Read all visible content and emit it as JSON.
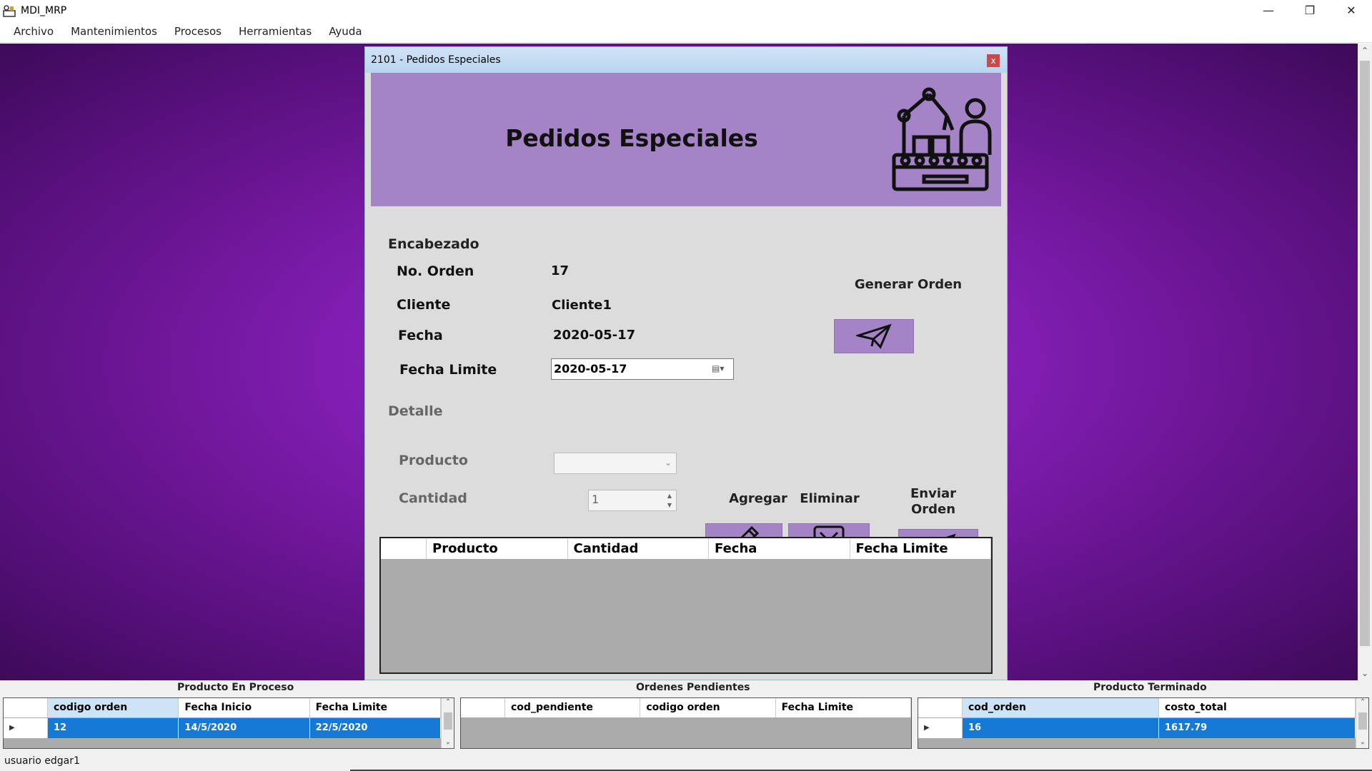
{
  "window": {
    "title": "MDI_MRP"
  },
  "menu": [
    "Archivo",
    "Mantenimientos",
    "Procesos",
    "Herramientas",
    "Ayuda"
  ],
  "child": {
    "title": "2101 - Pedidos Especiales",
    "close": "x",
    "banner_title": "Pedidos Especiales",
    "encabezado": {
      "section": "Encabezado",
      "orden_label": "No. Orden",
      "orden_value": "17",
      "cliente_label": "Cliente",
      "cliente_value": "Cliente1",
      "fecha_label": "Fecha",
      "fecha_value": "2020-05-17",
      "fecha_limite_label": "Fecha Limite",
      "fecha_limite_value": "2020-05-17",
      "generar_label": "Generar Orden"
    },
    "detalle": {
      "section": "Detalle",
      "producto_label": "Producto",
      "producto_value": "",
      "cantidad_label": "Cantidad",
      "cantidad_value": "1",
      "agregar_label": "Agregar",
      "eliminar_label": "Eliminar",
      "enviar_label": "Enviar Orden"
    },
    "grid_columns": [
      "Producto",
      "Cantidad",
      "Fecha",
      "Fecha Limite"
    ]
  },
  "panels": {
    "en_proceso": {
      "title": "Producto En Proceso",
      "columns": [
        "codigo orden",
        "Fecha Inicio",
        "Fecha Limite"
      ],
      "rows": [
        [
          "12",
          "14/5/2020",
          "22/5/2020"
        ]
      ]
    },
    "pendientes": {
      "title": "Ordenes Pendientes",
      "columns": [
        "cod_pendiente",
        "codigo orden",
        "Fecha Limite"
      ],
      "rows": []
    },
    "terminado": {
      "title": "Producto Terminado",
      "columns": [
        "cod_orden",
        "costo_total"
      ],
      "rows": [
        [
          "16",
          "1617.79"
        ]
      ]
    }
  },
  "status": {
    "label": "usuario",
    "user": "edgar1"
  },
  "colors": {
    "banner": "#a484c6",
    "selection": "#1679d6",
    "mdi_bg": "#8a22c0"
  }
}
